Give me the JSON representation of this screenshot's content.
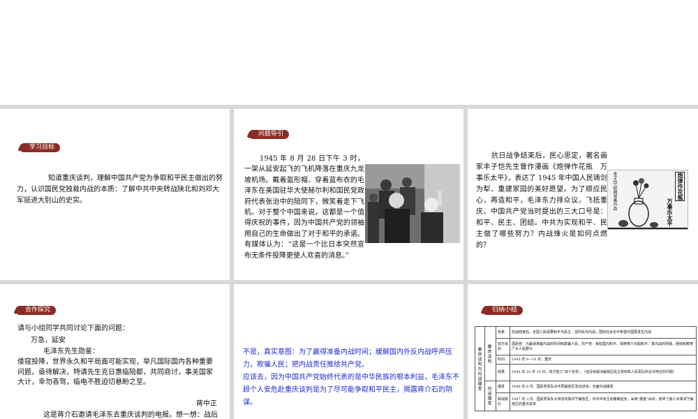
{
  "slide1": {
    "badge": "学习目标",
    "text": "知道重庆谈判，理解中国共产党为争取和平民主做出的努力，认识国民党独裁内战的本质：了解中共中央转战陕北和刘邓大军挺进大别山的史实。"
  },
  "slide2": {
    "badge": "问题导引",
    "text": "1945 年 8 月 28 日下午 3 时，一架从延安起飞的飞机降落在重庆九龙坡机场。戴着盔形帽、穿着蓝布衣的毛泽东在美国驻华大使赫尔利和国民党政府代表张治中的陪同下，微笑着走下飞机。对于整个中国来说，这都是一个值得庆祝的事件，因为中国共产党的领袖用自己的生命做出了对于和平的承诺。有媒体认为：“这是一个比日本突然宣布无条件投降更使人欢喜的消息。”"
  },
  "slide3": {
    "text": "抗日战争结束后，民心思定，著名画家丰子恺先生曾作漫画《炮弹作花瓶　万事乐太平》，表达了 1945 年中国人民铸剑为犁、重建家园的美好愿望。为了顺应民心，再造和平，毛泽东力排众议，飞抵重庆。中国共产党当时提出的三大口号是：和平、民主、团结。中共为实现和平、民主做了哪些努力？内战烽火是如何点燃的？",
    "poster_title": "炮弹作花瓶",
    "poster_sub": "万事乐太平",
    "poster_side": "丰子恺·经典漫画作品"
  },
  "slide4": {
    "badge": "合作探究",
    "lines": [
      "请与小组同学共同讨论下面的问题：",
      "万急，延安",
      "毛泽东先生勋鉴：",
      "倭寇投降，世界永久和平局面可能实现，举凡国际国内各种重要",
      "问题，亟待解决，特请先生克日惠临陪都，共同商讨，事关国家",
      "大计，幸勿吝驾，临电不胜迫切悬盼之至。",
      "蒋中正",
      "这是蒋介石邀请毛泽东去重庆谈判的电报。想一想：战后"
    ]
  },
  "slide5": {
    "p1": "不是，真实意图：为了赢得准备内战时间；缓解国内外反内战呼声压力，欺骗人民；把内战责任推给共产党。",
    "p2": "应该去，因为中国共产党始终代表的是中华民族的根本利益，毛泽东不顾个人安危赴重庆谈判是为了尽可能争取和平民主，揭露蒋介石的阴谋。"
  },
  "slide6": {
    "badge": "归纳小结",
    "side_label": "重庆谈判与内战爆发",
    "group1": "重庆谈判",
    "group2": "内战爆发",
    "rows": [
      {
        "k": "背景",
        "v": "抗战结束后，全国人民需要和平与民主，强烈反对内战，国际社会也不希望中国再发生内战"
      },
      {
        "k": "双方目的",
        "v": "国民党：为赢得准备内战的时间和欺骗人民；共产党：争取国内和平，揭穿蒋介石假和平、真内战的阴谋，团结和教育广大人民群众"
      },
      {
        "k": "时间",
        "v": "1945 年 8—10 月，重庆"
      },
      {
        "k": "结果",
        "v": "1945 年 10 月 10 日，双方签订“双十协定”。（但没有解决解放区民主政权和人民军队的合法地位的问题）"
      },
      {
        "k": "爆发",
        "v": "1946 年 6 月，国民党军队对中原解放区发动进攻，全面内战爆发"
      },
      {
        "k": "转战陕北",
        "v": "1947 年 3 月，国民党军队大举进攻陕甘宁解放区，中共中央主动撤离延安，采用“蘑菇”战术，粉碎了敌人对陕甘宁解放区的重点进攻"
      }
    ]
  },
  "colors": {
    "badge": "#8b2b24",
    "answer_text": "#1c2ad1",
    "gap": "#d9d9d9"
  }
}
